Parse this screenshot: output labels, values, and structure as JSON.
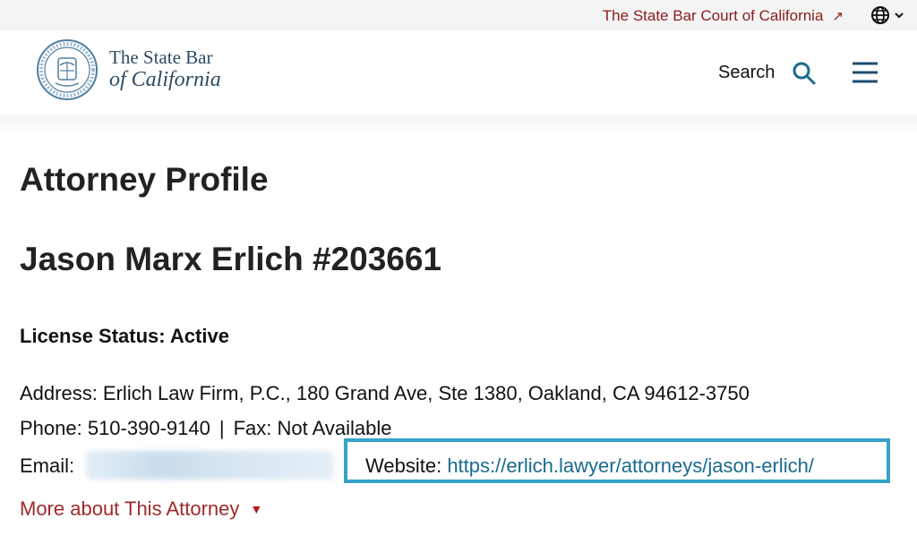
{
  "topbar": {
    "court_link": "The State Bar Court of California",
    "external_icon": "arrow-up-right-icon",
    "globe_icon": "globe-icon",
    "chevron_icon": "chevron-down-icon"
  },
  "header": {
    "logo_line1": "The State Bar",
    "logo_line2": "of California",
    "search_label": "Search",
    "search_icon": "search-icon",
    "menu_icon": "hamburger-menu-icon"
  },
  "main": {
    "page_title": "Attorney Profile",
    "attorney_name": "Jason Marx Erlich #203661",
    "license_status": "License Status: Active",
    "address": "Address: Erlich Law Firm, P.C., 180 Grand Ave, Ste 1380, Oakland, CA 94612-3750",
    "phone": "Phone: 510-390-9140",
    "separator": "|",
    "fax": "Fax: Not Available",
    "email_label": "Email:",
    "website_label": "Website:",
    "website_url": "https://erlich.lawyer/attorneys/jason-erlich/",
    "more_link": "More about This Attorney",
    "more_icon": "triangle-down-icon"
  },
  "colors": {
    "accent_red": "#a02a2a",
    "link_blue": "#1b6a8f",
    "highlight_box": "#36a2c8",
    "logo_blue": "#2c4a63"
  }
}
